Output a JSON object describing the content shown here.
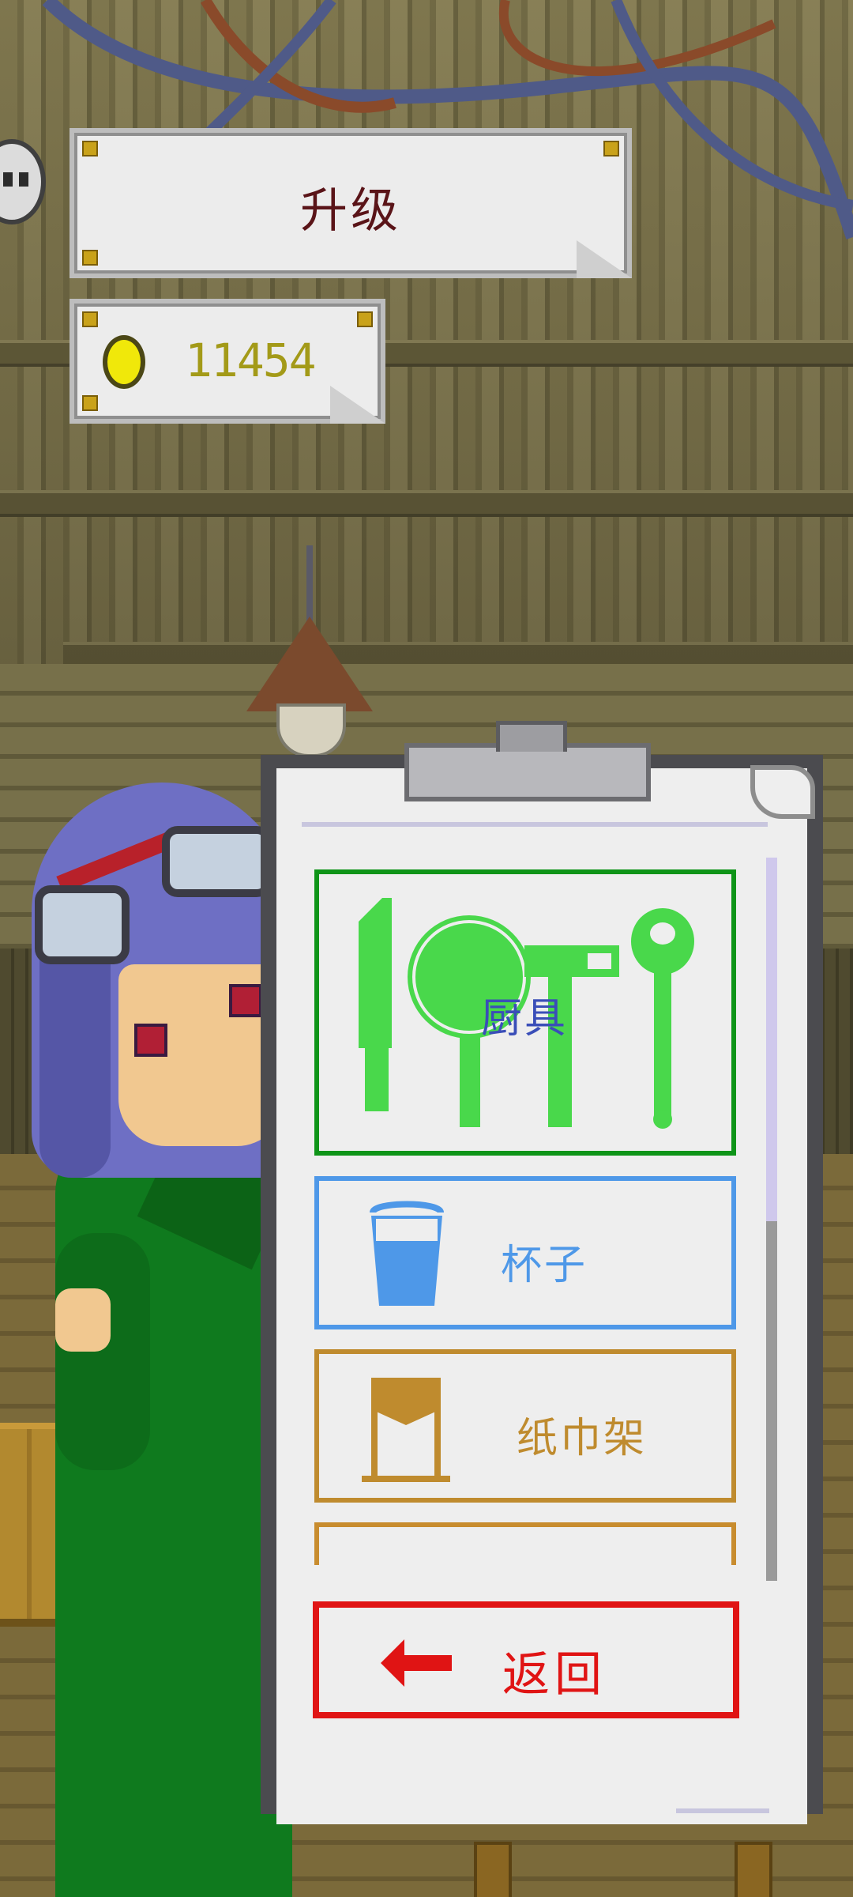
{
  "header": {
    "title": "升级"
  },
  "currency": {
    "coins": "11454",
    "icon": "gold-coin-icon"
  },
  "menu": {
    "items": [
      {
        "label": "厨具",
        "icon": "kitchenware-icon",
        "color": "#0e9418",
        "selected": true
      },
      {
        "label": "杯子",
        "icon": "cup-icon",
        "color": "#4e98e8"
      },
      {
        "label": "纸巾架",
        "icon": "napkin-holder-icon",
        "color": "#bf8b2e"
      }
    ],
    "back_label": "返回",
    "back_icon": "back-arrow-icon",
    "back_color": "#e01414"
  },
  "colors": {
    "accent_green": "#0e9418",
    "icon_green": "#49d84b",
    "title_text": "#5a1418",
    "coin_text": "#a39a18"
  }
}
